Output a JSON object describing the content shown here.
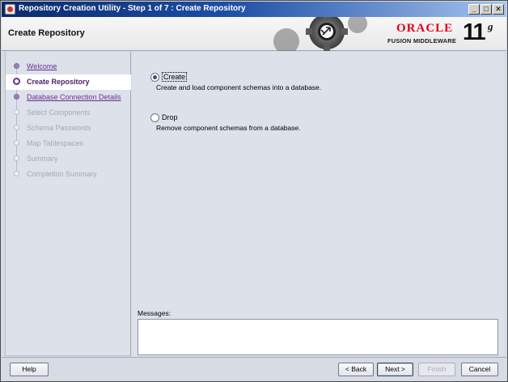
{
  "window": {
    "title": "Repository Creation Utility - Step 1 of 7 : Create Repository",
    "min_glyph": "_",
    "max_glyph": "□",
    "close_glyph": "✕"
  },
  "header": {
    "page_title": "Create Repository",
    "brand_word": "ORACLE",
    "brand_sub": "FUSION MIDDLEWARE",
    "version_num": "11",
    "version_suffix": "g"
  },
  "nav": {
    "items": [
      {
        "label": "Welcome",
        "state": "done"
      },
      {
        "label": "Create Repository",
        "state": "current"
      },
      {
        "label": "Database Connection Details",
        "state": "done"
      },
      {
        "label": "Select Components",
        "state": "pending"
      },
      {
        "label": "Schema Passwords",
        "state": "pending"
      },
      {
        "label": "Map Tablespaces",
        "state": "pending"
      },
      {
        "label": "Summary",
        "state": "pending"
      },
      {
        "label": "Completion Summary",
        "state": "pending"
      }
    ]
  },
  "content": {
    "create_label": "Create",
    "create_desc": "Create and load component schemas into a database.",
    "create_selected": true,
    "drop_label": "Drop",
    "drop_desc": "Remove component schemas from a database.",
    "drop_selected": false,
    "messages_label": "Messages:",
    "messages_text": ""
  },
  "footer": {
    "help": "Help",
    "back": "< Back",
    "next": "Next >",
    "finish": "Finish",
    "cancel": "Cancel"
  },
  "colors": {
    "accent_purple": "#6b2f8f",
    "oracle_red": "#e2001a",
    "titlebar_blue": "#0a2a6b"
  }
}
